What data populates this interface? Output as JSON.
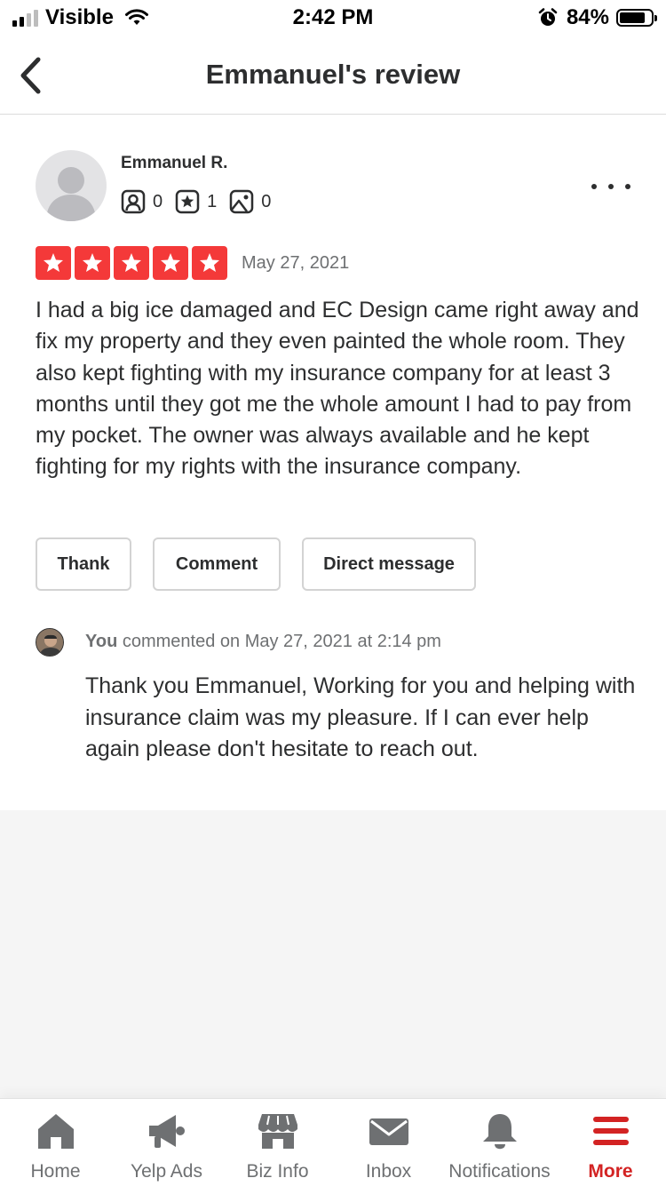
{
  "status_bar": {
    "carrier": "Visible",
    "time": "2:42 PM",
    "battery": "84%"
  },
  "nav": {
    "title": "Emmanuel's review"
  },
  "review": {
    "reviewer_name": "Emmanuel R.",
    "friends_count": "0",
    "reviews_count": "1",
    "photos_count": "0",
    "rating": 5,
    "date": "May 27, 2021",
    "text": "I had a big ice damaged and EC Design came right away and fix my property and they even painted the whole room. They also kept fighting with my insurance company for at least 3 months until they got me the whole amount I had to pay from my pocket. The owner was always available and he kept fighting for my rights with the insurance company.",
    "buttons": {
      "thank": "Thank",
      "comment": "Comment",
      "direct_message": "Direct message"
    }
  },
  "owner_comment": {
    "author": "You",
    "meta": "commented on May 27, 2021 at 2:14 pm",
    "text": "Thank you Emmanuel, Working for you and helping with  insurance claim was my pleasure. If I can ever help again please don't hesitate to reach out."
  },
  "tabs": [
    {
      "label": "Home",
      "icon": "home-icon"
    },
    {
      "label": "Yelp Ads",
      "icon": "megaphone-icon"
    },
    {
      "label": "Biz Info",
      "icon": "storefront-icon"
    },
    {
      "label": "Inbox",
      "icon": "envelope-icon"
    },
    {
      "label": "Notifications",
      "icon": "bell-icon"
    },
    {
      "label": "More",
      "icon": "menu-icon",
      "active": true
    }
  ],
  "colors": {
    "accent": "#d32323",
    "star": "#f43939",
    "text": "#2d2e2f",
    "muted": "#6e7072"
  }
}
